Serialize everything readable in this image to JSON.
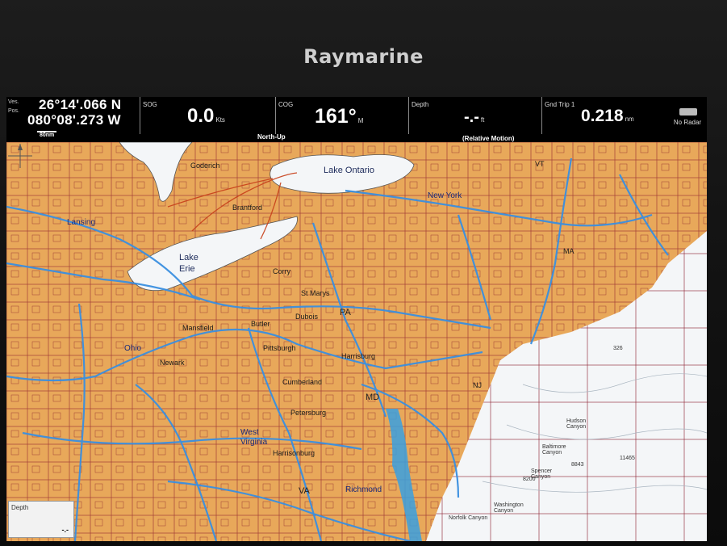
{
  "device": {
    "brand": "Raymarine"
  },
  "databar": {
    "position": {
      "label_1": "Ves.",
      "label_2": "Pos.",
      "lat": "26°14'.066 N",
      "lon": "080°08'.273 W",
      "scale": "80nm"
    },
    "sog": {
      "label": "SOG",
      "value": "0.0",
      "unit": "Kts"
    },
    "orientation": "North-Up",
    "cog": {
      "label": "COG",
      "value": "161°",
      "unit": "M"
    },
    "motion_mode": "(Relative Motion)",
    "depth": {
      "label": "Depth",
      "value": "-.-",
      "unit": "ft"
    },
    "trip": {
      "label": "Gnd Trip 1",
      "value": "0.218",
      "unit": "nm"
    },
    "radar": {
      "label": "No Radar",
      "icon": "radar-icon"
    }
  },
  "map": {
    "colors": {
      "land": "#e8a85a",
      "water": "#f4f6f8",
      "roads": "#3a8fe0",
      "chart_lines": "#8a1a2a"
    },
    "labels": {
      "goderich": "Goderich",
      "lake_ontario": "Lake Ontario",
      "brantford": "Brantford",
      "new_york": "New York",
      "vt": "VT",
      "lansing": "Lansing",
      "lake_erie_1": "Lake",
      "lake_erie_2": "Erie",
      "corry": "Corry",
      "st_marys": "St Marys",
      "pa": "PA",
      "dubois": "Dubois",
      "butler": "Butler",
      "mansfield": "Mansfield",
      "ohio": "Ohio",
      "newark": "Newark",
      "pittsburgh": "Pittsburgh",
      "harrisburg": "Harrisburg",
      "cumberland": "Cumberland",
      "md": "MD",
      "nj": "NJ",
      "ma": "MA",
      "petersburg": "Petersburg",
      "wv_1": "West",
      "wv_2": "Virginia",
      "harrisonburg": "Harrisonburg",
      "va": "VA",
      "richmond": "Richmond",
      "hudson_canyon": "Hudson Canyon",
      "baltimore_canyon": "Baltimore Canyon",
      "washington_canyon": "Washington Canyon",
      "norfolk_canyon": "Norfolk Canyon",
      "spencer_canyon": "Spencer Canyon",
      "depth_8200": "8200",
      "depth_8843": "8843",
      "depth_11465": "11465",
      "depth_326": "326"
    },
    "depth_box": {
      "label": "Depth",
      "value": "-.-"
    }
  }
}
